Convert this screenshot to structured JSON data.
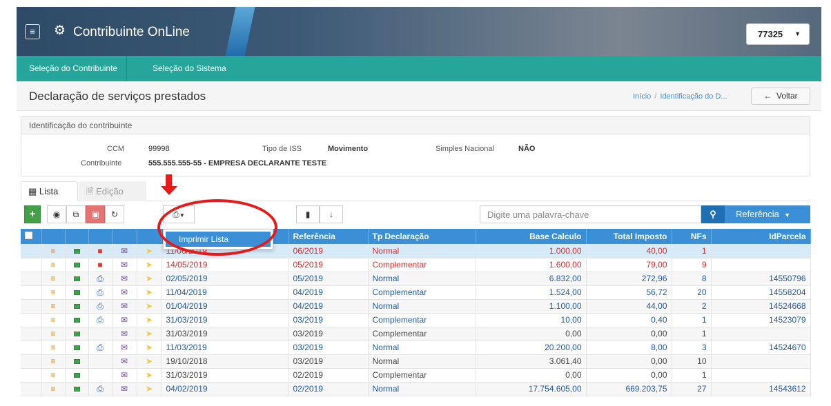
{
  "header": {
    "menu_icon": "hamburger-icon",
    "gear_icon": "gear-icon",
    "title": "Contribuinte OnLine",
    "user_code": "77325"
  },
  "nav": {
    "items": [
      "Seleção do Contribuinte",
      "Seleção do Sistema"
    ]
  },
  "page": {
    "title": "Declaração de serviços prestados",
    "breadcrumb": [
      "Início",
      "Identificação do D..."
    ],
    "back_label": "Voltar"
  },
  "panel": {
    "title": "Identificação do contribuinte",
    "ccm_label": "CCM",
    "ccm_value": "99998",
    "contribuinte_label": "Contribuinte",
    "contribuinte_value": "555.555.555-55 - EMPRESA DECLARANTE TESTE",
    "tipo_iss_label": "Tipo de ISS",
    "tipo_iss_value": "Movimento",
    "simples_label": "Simples Nacional",
    "simples_value": "NÃO"
  },
  "tabs": [
    {
      "label": "Lista",
      "icon": "table-icon"
    },
    {
      "label": "Edição",
      "icon": "document-icon"
    }
  ],
  "toolbar": {
    "add_icon": "plus-icon",
    "view_icon": "eye-icon",
    "copy_icon": "copy-icon",
    "delete_icon": "trash-icon",
    "refresh_icon": "refresh-icon",
    "print_icon": "printer-icon",
    "book_icon": "book-icon",
    "download_icon": "download-icon",
    "search_placeholder": "Digite uma palavra-chave",
    "search_icon": "search-icon",
    "filter_label": "Referência"
  },
  "dropdown": {
    "item": "Imprimir Lista"
  },
  "table": {
    "columns": [
      "Referência",
      "Tp Declaração",
      "Base Calculo",
      "Total Imposto",
      "NFs",
      "IdParcela"
    ],
    "rows": [
      {
        "date": "11/06/2019",
        "ref": "06/2019",
        "tipo": "Normal",
        "base": "1.000,00",
        "imposto": "40,00",
        "nfs": "1",
        "parcela": "",
        "lock": true,
        "print": false,
        "color": "red"
      },
      {
        "date": "14/05/2019",
        "ref": "05/2019",
        "tipo": "Complementar",
        "base": "1.600,00",
        "imposto": "79,00",
        "nfs": "9",
        "parcela": "",
        "lock": true,
        "print": false,
        "color": "red"
      },
      {
        "date": "02/05/2019",
        "ref": "05/2019",
        "tipo": "Normal",
        "base": "6.832,00",
        "imposto": "272,96",
        "nfs": "8",
        "parcela": "14550796",
        "lock": false,
        "print": true,
        "color": "blue"
      },
      {
        "date": "11/04/2019",
        "ref": "04/2019",
        "tipo": "Complementar",
        "base": "1.524,00",
        "imposto": "56,72",
        "nfs": "20",
        "parcela": "14558204",
        "lock": false,
        "print": true,
        "color": "blue"
      },
      {
        "date": "01/04/2019",
        "ref": "04/2019",
        "tipo": "Normal",
        "base": "1.100,00",
        "imposto": "44,00",
        "nfs": "2",
        "parcela": "14524668",
        "lock": false,
        "print": true,
        "color": "blue"
      },
      {
        "date": "31/03/2019",
        "ref": "03/2019",
        "tipo": "Complementar",
        "base": "10,00",
        "imposto": "0,40",
        "nfs": "1",
        "parcela": "14523079",
        "lock": false,
        "print": true,
        "color": "blue"
      },
      {
        "date": "31/03/2019",
        "ref": "03/2019",
        "tipo": "Complementar",
        "base": "0,00",
        "imposto": "0,00",
        "nfs": "1",
        "parcela": "",
        "lock": false,
        "print": false,
        "color": "gray"
      },
      {
        "date": "11/03/2019",
        "ref": "03/2019",
        "tipo": "Normal",
        "base": "20.200,00",
        "imposto": "8,00",
        "nfs": "3",
        "parcela": "14524670",
        "lock": false,
        "print": true,
        "color": "blue"
      },
      {
        "date": "19/10/2018",
        "ref": "03/2019",
        "tipo": "Normal",
        "base": "3.061,40",
        "imposto": "0,00",
        "nfs": "10",
        "parcela": "",
        "lock": false,
        "print": false,
        "color": "gray"
      },
      {
        "date": "31/03/2019",
        "ref": "02/2019",
        "tipo": "Complementar",
        "base": "0,00",
        "imposto": "0,00",
        "nfs": "1",
        "parcela": "",
        "lock": false,
        "print": false,
        "color": "gray"
      },
      {
        "date": "04/02/2019",
        "ref": "02/2019",
        "tipo": "Normal",
        "base": "17.754.605,00",
        "imposto": "669.203,75",
        "nfs": "27",
        "parcela": "14543612",
        "lock": false,
        "print": true,
        "color": "blue"
      }
    ]
  },
  "colors": {
    "teal": "#26a69a",
    "table_header": "#3a8fd6",
    "annotation_red": "#e51a1a"
  }
}
